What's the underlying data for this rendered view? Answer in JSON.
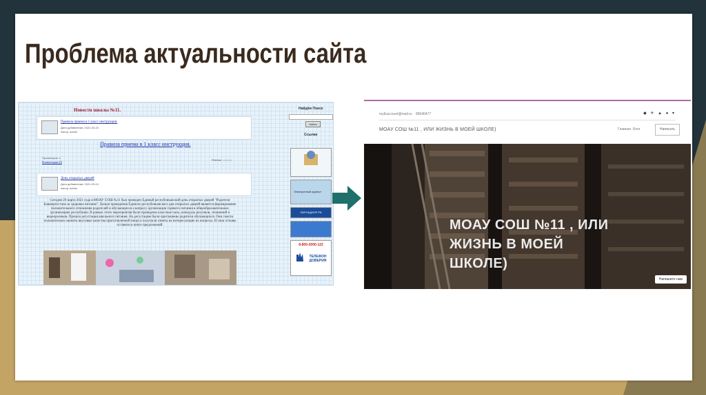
{
  "slide": {
    "title": "Проблема актуальности сайта"
  },
  "old_site": {
    "header": "Новости школы №11.",
    "news1": {
      "link": "Правила приема в 1 класс инструкция.",
      "date": "Дата добавления: 2021-03-15",
      "author": "Автор: admin",
      "body_link": "Правила приема в 1 класс инструкция.",
      "views": "Просмотров: 1",
      "comments": "Комментарии (0)",
      "rating": "Рейтинг: ○○○○○"
    },
    "news2": {
      "link": "День открытых дверей",
      "date": "Дата добавления: 2021-03-24",
      "author": "Автор: admin"
    },
    "paragraph": "Сегодня 29 марта 2021 года в МОАУ СОШ №11 был проведен Единый республиканский день открытых дверей \"Родители Башкортостана за здоровое питание\". Целью проведения Единого республиканского дня открытых дверей является формирование положительного отношения родителей и обучающихся к вопросу организации горячего питания в общеобразовательных организациях республики. В рамках этого мероприятия были проведены классные часы, конкурсы рисунков, сочинений и видеороликов. Прошла дегустация школьного питания. На дегустацию были приглашены родители обучающихся. Они смогли положительно оценить вкусовые качества приготовленной пищи и получили ответы на интересующие их вопросы. И свои отзывы оставили в книге предложений.",
    "sidebar": {
      "search_title": "Найдём Поиск",
      "search_button": "Найти",
      "links_title": "Ссылки",
      "banner1": "Электронный журнал",
      "banner2": "ОБРНАДЗОР РБ",
      "banner3": "8-800-2000-122",
      "banner4": "ТЕЛЕФОН ДОВЕРИЯ"
    }
  },
  "new_site": {
    "email": "myEaccount@mail.ru",
    "phone": "89040477",
    "icons": "◆ ✈ ▲ ● ▾",
    "brand": "МОАУ СОШ №11 , ИЛИ ЖИЗНЬ В МОЕЙ ШКОЛЕ)",
    "nav": [
      "Главная",
      "Блог"
    ],
    "nav_button": "Написать",
    "hero_title_lines": [
      "МОАУ СОШ №11 , ИЛИ",
      "ЖИЗНЬ В МОЕЙ",
      "ШКОЛЕ)"
    ],
    "chat_button": "Напишите нам"
  },
  "colors": {
    "arrow": "#1f6f6a",
    "title": "#3a2a1e",
    "accent_border": "#b06aa0"
  }
}
